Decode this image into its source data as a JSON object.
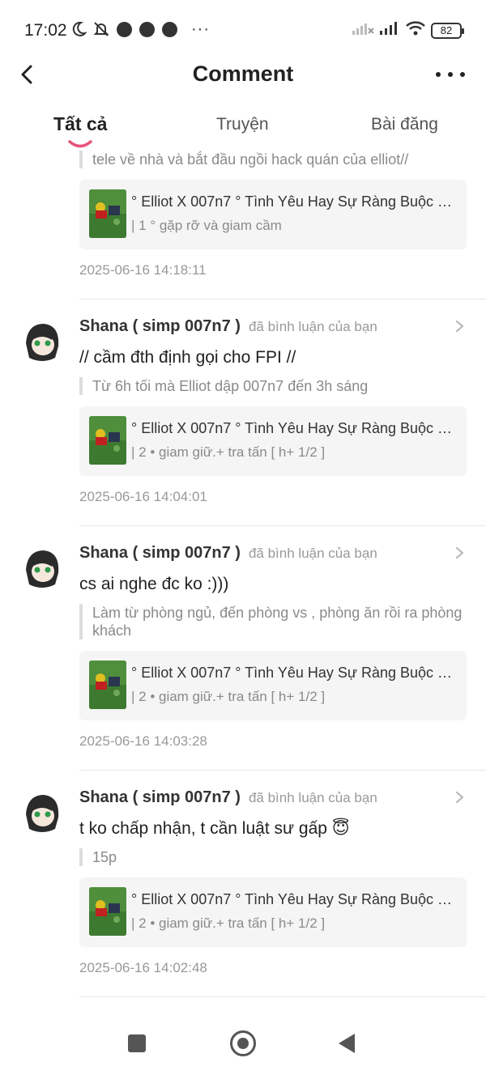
{
  "status_bar": {
    "time": "17:02",
    "battery": "82",
    "icons_left": [
      "moon-icon",
      "bell-muted-icon",
      "messenger-icon",
      "messenger-icon",
      "messenger-icon",
      "more-dots-icon"
    ],
    "icons_right": [
      "signal-off-icon",
      "signal-icon",
      "wifi-icon",
      "battery-icon"
    ]
  },
  "header": {
    "title": "Comment",
    "back_icon": "chevron-left-icon",
    "more_icon": "more-horizontal-icon"
  },
  "tabs": [
    {
      "label": "Tất cả",
      "active": true
    },
    {
      "label": "Truyện",
      "active": false
    },
    {
      "label": "Bài đăng",
      "active": false
    }
  ],
  "accent_color": "#e8537a",
  "top_partial": {
    "quote": "tele về nhà và bắt đầu ngồi hack quán của elliot//",
    "story_title": "° Elliot X 007n7 ° Tình Yêu Hay Sự Ràng Buộc ≥...",
    "story_sub": "| 1 ° gặp rỡ và giam cầm",
    "timestamp": "2025-06-16 14:18:11"
  },
  "comments": [
    {
      "user": "Shana ( simp 007n7 )",
      "action": "đã bình luận của bạn",
      "text": "// cầm đth định gọi cho FPI //",
      "quote": "Từ 6h tối mà Elliot dập 007n7 đến 3h sáng",
      "story_title": "° Elliot X 007n7 ° Tình Yêu Hay Sự Ràng Buộc ≥...",
      "story_sub": "| 2 • giam giữ.+ tra tấn [ h+ 1/2 ]",
      "timestamp": "2025-06-16 14:04:01"
    },
    {
      "user": "Shana ( simp 007n7 )",
      "action": "đã bình luận của bạn",
      "text": "cs ai nghe đc ko :)))",
      "quote": "Làm từ phòng ngủ, đến phòng vs , phòng ăn rồi ra phòng khách",
      "story_title": "° Elliot X 007n7 ° Tình Yêu Hay Sự Ràng Buộc ≥...",
      "story_sub": "| 2 • giam giữ.+ tra tấn [ h+ 1/2 ]",
      "timestamp": "2025-06-16 14:03:28"
    },
    {
      "user": "Shana ( simp 007n7 )",
      "action": "đã bình luận của bạn",
      "text": "t ko chấp nhận, t cần luật sư gấp 😇",
      "quote": "15p",
      "story_title": "° Elliot X 007n7 ° Tình Yêu Hay Sự Ràng Buộc ≥...",
      "story_sub": "| 2 • giam giữ.+ tra tấn [ h+ 1/2 ]",
      "timestamp": "2025-06-16 14:02:48"
    }
  ],
  "navbar": {
    "icons": [
      "recent-apps-icon",
      "home-icon",
      "back-icon"
    ]
  }
}
